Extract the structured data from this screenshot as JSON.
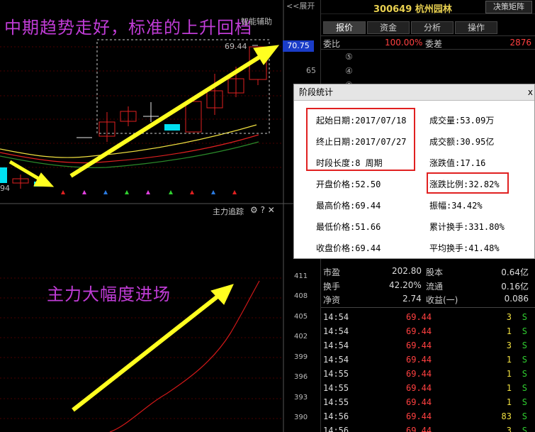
{
  "chart": {
    "headline": "中期趋势走好，标准的上升回档",
    "subline": "主力大幅度进场",
    "assist_label": "智能辅助",
    "expand_label": "<<展开",
    "current_price": "70.75",
    "price_label_65": "65",
    "max_label": "69.44",
    "min_label": "94",
    "tracker_title": "主力追踪",
    "tracker_icons": "⚙ ? ✕",
    "axis_labels": [
      "411",
      "408",
      "405",
      "402",
      "399",
      "396",
      "393",
      "390"
    ]
  },
  "stock": {
    "code": "300649",
    "name": "杭州园林",
    "decision_button": "决策矩阵"
  },
  "tabs": [
    "报价",
    "资金",
    "分析",
    "操作"
  ],
  "order_book": {
    "ratio_label": "委比",
    "ratio_value": "100.00%",
    "diff_label": "委差",
    "diff_value": "2876",
    "levels": [
      "⑤",
      "④",
      "③",
      "②",
      "①"
    ]
  },
  "quote": [
    {
      "l1": "市盈",
      "v1": "202.80",
      "l2": "股本",
      "v2": "0.64亿"
    },
    {
      "l1": "换手",
      "v1": "42.20%",
      "l2": "流通",
      "v2": "0.16亿"
    },
    {
      "l1": "净资",
      "v1": "2.74",
      "l2": "收益(一)",
      "v2": "0.086"
    }
  ],
  "ticks": [
    {
      "time": "14:54",
      "price": "69.44",
      "vol": "3",
      "side": "S"
    },
    {
      "time": "14:54",
      "price": "69.44",
      "vol": "1",
      "side": "S"
    },
    {
      "time": "14:54",
      "price": "69.44",
      "vol": "3",
      "side": "S"
    },
    {
      "time": "14:54",
      "price": "69.44",
      "vol": "1",
      "side": "S"
    },
    {
      "time": "14:55",
      "price": "69.44",
      "vol": "1",
      "side": "S"
    },
    {
      "time": "14:55",
      "price": "69.44",
      "vol": "1",
      "side": "S"
    },
    {
      "time": "14:55",
      "price": "69.44",
      "vol": "1",
      "side": "S"
    },
    {
      "time": "14:56",
      "price": "69.44",
      "vol": "83",
      "side": "S"
    },
    {
      "time": "14:56",
      "price": "69.44",
      "vol": "3",
      "side": "S"
    }
  ],
  "popup": {
    "title": "阶段统计",
    "close": "x",
    "start_date": "起始日期:2017/07/18",
    "end_date": "终止日期:2017/07/27",
    "duration": "时段长度:8 周期",
    "open_price": "开盘价格:52.50",
    "high_price": "最高价格:69.44",
    "low_price": "最低价格:51.66",
    "close_price": "收盘价格:69.44",
    "volume": "成交量:53.09万",
    "amount": "成交额:30.95亿",
    "change_value": "涨跌值:17.16",
    "change_pct": "涨跌比例:32.82%",
    "amplitude": "振幅:34.42%",
    "cum_turnover": "累计换手:331.80%",
    "avg_turnover": "平均换手:41.48%"
  },
  "colors": {
    "headline": "#c03cd6",
    "price_red": "#ff4040",
    "green_s": "#30d030",
    "volume_yellow": "#f0e040",
    "highlight_red": "#e02020",
    "arrow_yellow": "#ffff20",
    "price_tag_blue": "#1a3cc7"
  }
}
